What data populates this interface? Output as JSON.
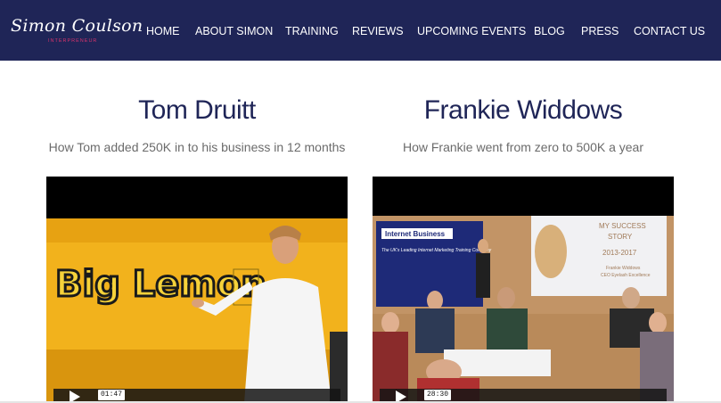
{
  "brand": {
    "name": "Simon Coulson",
    "tagline": "INTERPRENEUR"
  },
  "nav": {
    "items": [
      {
        "label": "HOME"
      },
      {
        "label": "ABOUT SIMON"
      },
      {
        "label": "TRAINING"
      },
      {
        "label": "REVIEWS"
      },
      {
        "label": "UPCOMING EVENTS"
      },
      {
        "label": "BLOG"
      },
      {
        "label": "PRESS"
      },
      {
        "label": "CONTACT US"
      }
    ]
  },
  "testimonials": [
    {
      "name": "Tom Druitt",
      "summary": "How Tom added 250K in to his business in 12 months",
      "video": {
        "duration": "01:47",
        "scene_text": "Big Lemon"
      }
    },
    {
      "name": "Frankie Widdows",
      "summary": "How Frankie went from zero to 500K a year",
      "video": {
        "duration": "28:30",
        "banner_title": "Internet Business",
        "banner_sub": "The UK's Leading Internet Marketing Training Company",
        "slide_lines": [
          "MY SUCCESS",
          "STORY",
          "2013-2017"
        ],
        "slide_caption_1": "Frankie Widdows",
        "slide_caption_2": "CEO Eyelash Excellence"
      }
    }
  ],
  "colors": {
    "navbar_bg": "#1f2557",
    "title": "#1f2557",
    "subtitle": "#6b6b6b",
    "tagline": "#d6336c",
    "lemon_bus": "#f2b21c"
  }
}
